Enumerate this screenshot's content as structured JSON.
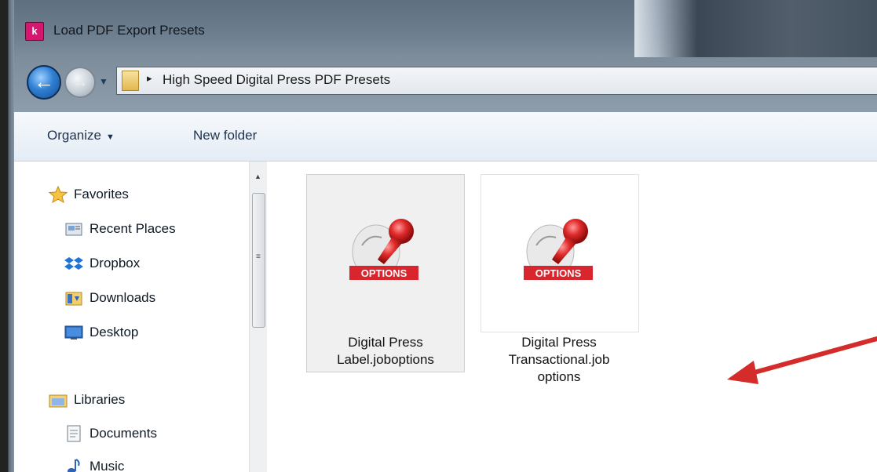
{
  "window": {
    "title": "Load PDF Export Presets",
    "app_icon_letter": "k"
  },
  "address": {
    "separator": "▸",
    "path": "High Speed Digital Press PDF Presets"
  },
  "toolbar": {
    "organize_label": "Organize",
    "new_folder_label": "New folder"
  },
  "sidebar": {
    "favorites": {
      "label": "Favorites",
      "items": [
        {
          "label": "Recent Places",
          "icon": "recent-places-icon"
        },
        {
          "label": "Dropbox",
          "icon": "dropbox-icon"
        },
        {
          "label": "Downloads",
          "icon": "downloads-folder-icon"
        },
        {
          "label": "Desktop",
          "icon": "desktop-icon"
        }
      ]
    },
    "libraries": {
      "label": "Libraries",
      "items": [
        {
          "label": "Documents",
          "icon": "documents-icon"
        },
        {
          "label": "Music",
          "icon": "music-icon"
        }
      ]
    }
  },
  "files": [
    {
      "name_line1": "Digital Press",
      "name_line2": "Label.joboptions",
      "name_line3": "",
      "icon": "joboptions-file-icon",
      "icon_text": "OPTIONS",
      "selected": true
    },
    {
      "name_line1": "Digital Press",
      "name_line2": "Transactional.job",
      "name_line3": "options",
      "icon": "joboptions-file-icon",
      "icon_text": "OPTIONS",
      "selected": false
    }
  ],
  "colors": {
    "annotation_arrow": "#d42b2b",
    "options_banner": "#d9262e",
    "accent": "#2f7fd3"
  }
}
